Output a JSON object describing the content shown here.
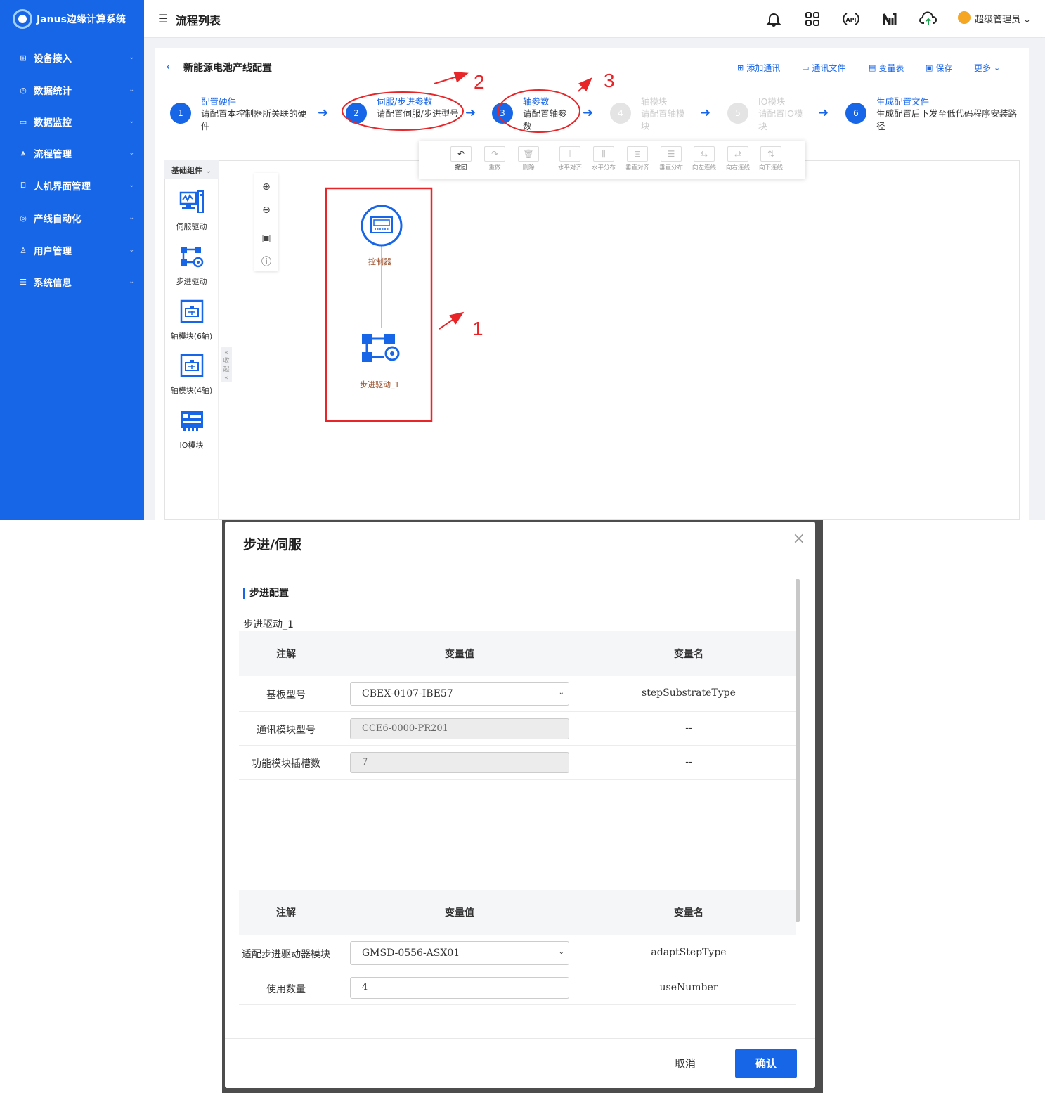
{
  "app": {
    "name": "Janus边缘计算系统"
  },
  "sidebar": {
    "items": [
      {
        "label": "设备接入",
        "icon": "devices-icon"
      },
      {
        "label": "数据统计",
        "icon": "clock-icon"
      },
      {
        "label": "数据监控",
        "icon": "monitor-icon"
      },
      {
        "label": "流程管理",
        "icon": "flow-icon"
      },
      {
        "label": "人机界面管理",
        "icon": "screen-icon"
      },
      {
        "label": "产线自动化",
        "icon": "target-icon"
      },
      {
        "label": "用户管理",
        "icon": "users-icon"
      },
      {
        "label": "系统信息",
        "icon": "settings-sliders-icon"
      }
    ]
  },
  "header": {
    "title": "流程列表",
    "user": "超级管理员",
    "icons": [
      "bell-icon",
      "apps-grid-icon",
      "api-icon",
      "ni-logo-icon",
      "cloud-upload-icon"
    ],
    "api_label": "API"
  },
  "page": {
    "title": "新能源电池产线配置",
    "actions": [
      {
        "label": "添加通讯"
      },
      {
        "label": "通讯文件"
      },
      {
        "label": "变量表"
      },
      {
        "label": "保存"
      },
      {
        "label": "更多"
      }
    ]
  },
  "steps": [
    {
      "num": "1",
      "title": "配置硬件",
      "desc": "请配置本控制器所关联的硬件",
      "state": "done"
    },
    {
      "num": "2",
      "title": "伺服/步进参数",
      "desc": "请配置伺服/步进型号",
      "state": "active"
    },
    {
      "num": "3",
      "title": "轴参数",
      "desc": "请配置轴参数",
      "state": "active"
    },
    {
      "num": "4",
      "title": "轴模块",
      "desc": "请配置轴模块",
      "state": "disabled"
    },
    {
      "num": "5",
      "title": "IO模块",
      "desc": "请配置IO模块",
      "state": "disabled"
    },
    {
      "num": "6",
      "title": "生成配置文件",
      "desc": "生成配置后下发至低代码程序安装路径",
      "state": "done"
    }
  ],
  "toolbar": [
    {
      "label": "撤回",
      "glyph": "↶",
      "active": true
    },
    {
      "label": "重做",
      "glyph": "↷",
      "active": false
    },
    {
      "label": "删除",
      "glyph": "🗑",
      "active": false
    },
    {
      "label": "水平对齐",
      "glyph": "⫴",
      "active": false
    },
    {
      "label": "水平分布",
      "glyph": "⫼",
      "active": false
    },
    {
      "label": "垂直对齐",
      "glyph": "⊟",
      "active": false
    },
    {
      "label": "垂直分布",
      "glyph": "☰",
      "active": false
    },
    {
      "label": "向左连线",
      "glyph": "⇆",
      "active": false
    },
    {
      "label": "向右连线",
      "glyph": "⇄",
      "active": false
    },
    {
      "label": "向下连线",
      "glyph": "⇅",
      "active": false
    }
  ],
  "palette": {
    "tab": "基础组件",
    "collapse_label": "收起",
    "items": [
      {
        "label": "伺服驱动"
      },
      {
        "label": "步进驱动"
      },
      {
        "label": "轴模块(6轴)"
      },
      {
        "label": "轴模块(4轴)"
      },
      {
        "label": "IO模块"
      }
    ]
  },
  "canvas": {
    "nodes": [
      {
        "label": "控制器"
      },
      {
        "label": "步进驱动_1"
      }
    ]
  },
  "annotations": {
    "marks": [
      "1",
      "2",
      "3"
    ],
    "color": "#e8262a"
  },
  "modal": {
    "title": "步进/伺服",
    "section": "步进配置",
    "subtitle": "步进驱动_1",
    "table1": {
      "headers": [
        "注解",
        "变量值",
        "变量名"
      ],
      "rows": [
        {
          "label": "基板型号",
          "value": "CBEX-0107-IBE57",
          "name": "stepSubstrateType",
          "kind": "select"
        },
        {
          "label": "通讯模块型号",
          "value": "CCE6-0000-PR201",
          "name": "--",
          "kind": "disabled"
        },
        {
          "label": "功能模块插槽数",
          "value": "7",
          "name": "--",
          "kind": "disabled"
        }
      ]
    },
    "table2": {
      "headers": [
        "注解",
        "变量值",
        "变量名"
      ],
      "rows": [
        {
          "label": "适配步进驱动器模块",
          "value": "GMSD-0556-ASX01",
          "name": "adaptStepType",
          "kind": "select"
        },
        {
          "label": "使用数量",
          "value": "4",
          "name": "useNumber",
          "kind": "input"
        }
      ]
    },
    "cancel": "取消",
    "confirm": "确认"
  },
  "colors": {
    "primary": "#1766e8",
    "annotation": "#e8262a",
    "node_label": "#a0522d"
  }
}
